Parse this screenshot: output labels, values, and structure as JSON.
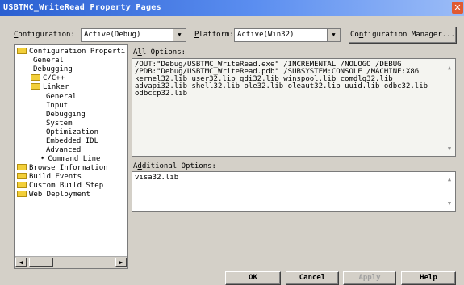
{
  "window": {
    "title": "USBTMC_WriteRead Property Pages",
    "close_glyph": "✕"
  },
  "config_bar": {
    "configuration_label_first": "C",
    "configuration_label_rest": "onfiguration:",
    "configuration_value": "Active(Debug)",
    "platform_label_first": "P",
    "platform_label_rest": "latform:",
    "platform_value": "Active(Win32)",
    "config_manager_label_first": "Co",
    "config_manager_label_underlined": "n",
    "config_manager_label_rest": "figuration Manager..."
  },
  "tree": {
    "items": [
      {
        "label": "Configuration Properti",
        "icon": "folder-open-icon"
      },
      {
        "label": "General"
      },
      {
        "label": "Debugging"
      },
      {
        "label": "C/C++",
        "icon": "folder-icon"
      },
      {
        "label": "Linker",
        "icon": "folder-open-icon"
      },
      {
        "label": "General"
      },
      {
        "label": "Input"
      },
      {
        "label": "Debugging"
      },
      {
        "label": "System"
      },
      {
        "label": "Optimization"
      },
      {
        "label": "Embedded IDL"
      },
      {
        "label": "Advanced"
      },
      {
        "label": "Command Line",
        "icon": "arrow-pointer-icon"
      },
      {
        "label": "Browse Information",
        "icon": "folder-icon"
      },
      {
        "label": "Build Events",
        "icon": "folder-icon"
      },
      {
        "label": "Custom Build Step",
        "icon": "folder-icon"
      },
      {
        "label": "Web Deployment",
        "icon": "folder-icon"
      }
    ]
  },
  "all_options": {
    "label_first": "A",
    "label_underlined": "l",
    "label_rest": "l Options:",
    "text": "/OUT:\"Debug/USBTMC_WriteRead.exe\" /INCREMENTAL /NOLOGO /DEBUG\n/PDB:\"Debug/USBTMC_WriteRead.pdb\" /SUBSYSTEM:CONSOLE /MACHINE:X86\nkernel32.lib user32.lib gdi32.lib winspool.lib comdlg32.lib\nadvapi32.lib shell32.lib ole32.lib oleaut32.lib uuid.lib odbc32.lib\nodbccp32.lib"
  },
  "additional_options": {
    "label_first": "A",
    "label_underlined": "d",
    "label_rest": "ditional Options:",
    "text": "visa32.lib"
  },
  "buttons": {
    "ok": "OK",
    "cancel": "Cancel",
    "apply": "Apply",
    "help": "Help"
  },
  "icons": {
    "dropdown_arrow": "▼",
    "scroll_up": "▲",
    "scroll_down": "▼",
    "scroll_left": "◀",
    "scroll_right": "▶"
  }
}
